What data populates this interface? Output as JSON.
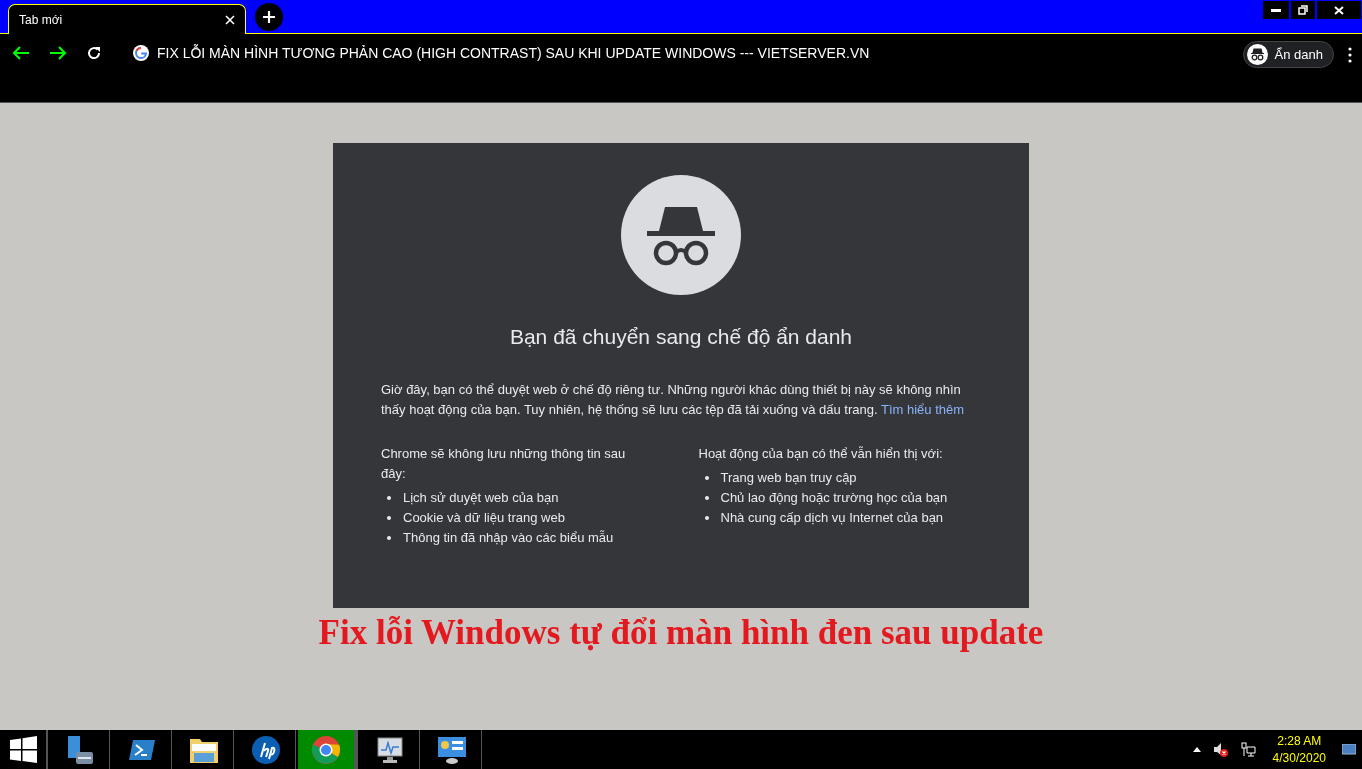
{
  "tab": {
    "title": "Tab mới"
  },
  "toolbar": {
    "address": "FIX LỖI MÀN HÌNH TƯƠNG PHẢN CAO (HIGH CONTRAST) SAU KHI UPDATE WINDOWS --- VIETSERVER.VN",
    "profile_label": "Ẩn danh"
  },
  "incognito": {
    "heading": "Bạn đã chuyển sang chế độ ẩn danh",
    "intro": "Giờ đây, bạn có thể duyệt web ở chế độ riêng tư. Những người khác dùng thiết bị này sẽ không nhìn thấy hoạt động của bạn. Tuy nhiên, hệ thống sẽ lưu các tệp đã tải xuống và dấu trang.",
    "learn_more": "Tìm hiểu thêm",
    "columns": [
      {
        "title": "Chrome sẽ không lưu những thông tin sau đây:",
        "items": [
          "Lịch sử duyệt web của bạn",
          "Cookie và dữ liệu trang web",
          "Thông tin đã nhập vào các biểu mẫu"
        ]
      },
      {
        "title": "Hoạt động của bạn có thể vẫn hiển thị với:",
        "items": [
          "Trang web bạn truy cập",
          "Chủ lao động hoặc trường học của bạn",
          "Nhà cung cấp dịch vụ Internet của bạn"
        ]
      }
    ]
  },
  "caption": "Fix lỗi Windows tự đổi màn hình đen sau update",
  "taskbar": {
    "apps": [
      {
        "kind": "server",
        "selected": false
      },
      {
        "kind": "powershell",
        "selected": false
      },
      {
        "kind": "folder",
        "selected": false
      },
      {
        "kind": "hp",
        "selected": false
      },
      {
        "kind": "chrome",
        "selected": true
      },
      {
        "kind": "monitor",
        "selected": false
      },
      {
        "kind": "control",
        "selected": false
      }
    ],
    "time": "2:28 AM",
    "date": "4/30/2020"
  }
}
